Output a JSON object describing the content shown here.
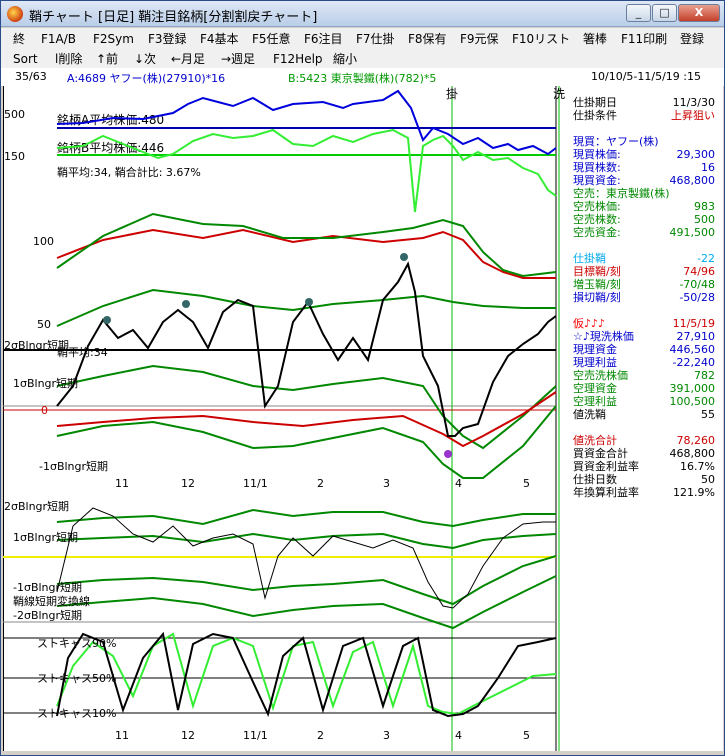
{
  "window": {
    "title": "鞘チャート [日足] 鞘注目銘柄[分割割戻チャート]",
    "buttons": {
      "minimize": "_",
      "maximize": "□",
      "close": "X"
    }
  },
  "menu": {
    "row1": [
      "終",
      "F1A/B",
      "F2Sym",
      "F3登録",
      "F4基本",
      "F5任意",
      "F6注目",
      "F7仕掛",
      "F8保有",
      "F9元保",
      "F10リスト",
      "箸棒",
      "F11印刷",
      "登録"
    ],
    "row2": [
      "Sort",
      "l削除",
      "↑前",
      "↓次",
      "←月足",
      "→週足",
      "F12Help",
      "縮小"
    ]
  },
  "status": {
    "counter": "35/63",
    "stock_a": "A:4689 ヤフー(株)(27910)*16",
    "stock_b": "B:5423 東京製鐵(株)(782)*5",
    "range": "10/10/5-11/5/19 :15"
  },
  "chart": {
    "labels": {
      "kake": "掛",
      "arai": "洗",
      "avg_a": "銘柄A平均株価:480",
      "avg_b": "銘柄B平均株価:446",
      "ratio": "鞘平均:34, 鞘合計比: 3.67%",
      "sigma2": "2σBlngr短期",
      "sigma2_kanji": "鞘平均:34",
      "sigma1": "1σBlngr短期",
      "sigma_m1": "-1σBlngr短期",
      "sigma_m2": "-2σBlngr短期",
      "sigma2b": "2σBlngr短期",
      "sigma1b": "1σBlngr短期",
      "sigma_m1b": "-1σBlngr短期",
      "conv": "鞘線短期変換線",
      "sigma_m2b": "-2σBlngr短期",
      "stoch90": "ストキャス90%",
      "stoch50": "ストキャス50%",
      "stoch10": "ストキャス10%"
    },
    "y_ticks_top": [
      "500",
      "150"
    ],
    "y_ticks_mid": [
      "100",
      "50",
      "0"
    ],
    "months": [
      "11",
      "12",
      "11/1",
      "2",
      "3",
      "4",
      "5"
    ]
  },
  "panel": {
    "rows": [
      {
        "k": "仕掛期日",
        "v": "11/3/30",
        "kc": "#000000",
        "vc": "#000000"
      },
      {
        "k": "仕掛条件",
        "v": "上昇狙い",
        "kc": "#000000",
        "vc": "#cc0000"
      },
      {
        "k": "",
        "v": "",
        "kc": "#000000",
        "vc": "#000000"
      },
      {
        "k": "現買：ヤフー(株)",
        "v": "",
        "kc": "#0000cc",
        "vc": "#0000cc"
      },
      {
        "k": "現買株価:",
        "v": "29,300",
        "kc": "#0000cc",
        "vc": "#0000cc"
      },
      {
        "k": "現買株数:",
        "v": "16",
        "kc": "#0000cc",
        "vc": "#0000cc"
      },
      {
        "k": "現買資金:",
        "v": "468,800",
        "kc": "#0000cc",
        "vc": "#0000cc"
      },
      {
        "k": "空売：東京製鐵(株)",
        "v": "",
        "kc": "#008800",
        "vc": "#008800"
      },
      {
        "k": "空売株価:",
        "v": "983",
        "kc": "#008800",
        "vc": "#008800"
      },
      {
        "k": "空売株数:",
        "v": "500",
        "kc": "#008800",
        "vc": "#008800"
      },
      {
        "k": "空売資金:",
        "v": "491,500",
        "kc": "#008800",
        "vc": "#008800"
      },
      {
        "k": "",
        "v": "",
        "kc": "#000000",
        "vc": "#000000"
      },
      {
        "k": "仕掛鞘",
        "v": "-22",
        "kc": "#00aaee",
        "vc": "#00aaee"
      },
      {
        "k": "目標鞘/刻",
        "v": "74/96",
        "kc": "#cc0000",
        "vc": "#cc0000"
      },
      {
        "k": "増玉鞘/刻",
        "v": "-70/48",
        "kc": "#008800",
        "vc": "#008800"
      },
      {
        "k": "損切鞘/刻",
        "v": "-50/28",
        "kc": "#0000cc",
        "vc": "#0000cc"
      },
      {
        "k": "",
        "v": "",
        "kc": "#000000",
        "vc": "#000000"
      },
      {
        "k": "仮♪♪♪",
        "v": "11/5/19",
        "kc": "#ff0000",
        "vc": "#cc0000"
      },
      {
        "k": "☆♪現洗株価",
        "v": "27,910",
        "kc": "#0000cc",
        "vc": "#0000cc"
      },
      {
        "k": "現理資金",
        "v": "446,560",
        "kc": "#0000cc",
        "vc": "#0000cc"
      },
      {
        "k": "現理利益",
        "v": "-22,240",
        "kc": "#0000cc",
        "vc": "#0000cc"
      },
      {
        "k": "空売洗株価",
        "v": "782",
        "kc": "#008800",
        "vc": "#008800"
      },
      {
        "k": "空理資金",
        "v": "391,000",
        "kc": "#008800",
        "vc": "#008800"
      },
      {
        "k": "空理利益",
        "v": "100,500",
        "kc": "#008800",
        "vc": "#008800"
      },
      {
        "k": "値洗鞘",
        "v": "55",
        "kc": "#000000",
        "vc": "#000000"
      },
      {
        "k": "",
        "v": "",
        "kc": "#000000",
        "vc": "#000000"
      },
      {
        "k": "値洗合計",
        "v": "78,260",
        "kc": "#cc0000",
        "vc": "#cc0000"
      },
      {
        "k": "買資金合計",
        "v": "468,800",
        "kc": "#000000",
        "vc": "#000000"
      },
      {
        "k": "買資金利益率",
        "v": "16.7%",
        "kc": "#000000",
        "vc": "#000000"
      },
      {
        "k": "仕掛日数",
        "v": "50",
        "kc": "#000000",
        "vc": "#000000"
      },
      {
        "k": "年換算利益率",
        "v": "121.9%",
        "kc": "#000000",
        "vc": "#000000"
      }
    ]
  }
}
